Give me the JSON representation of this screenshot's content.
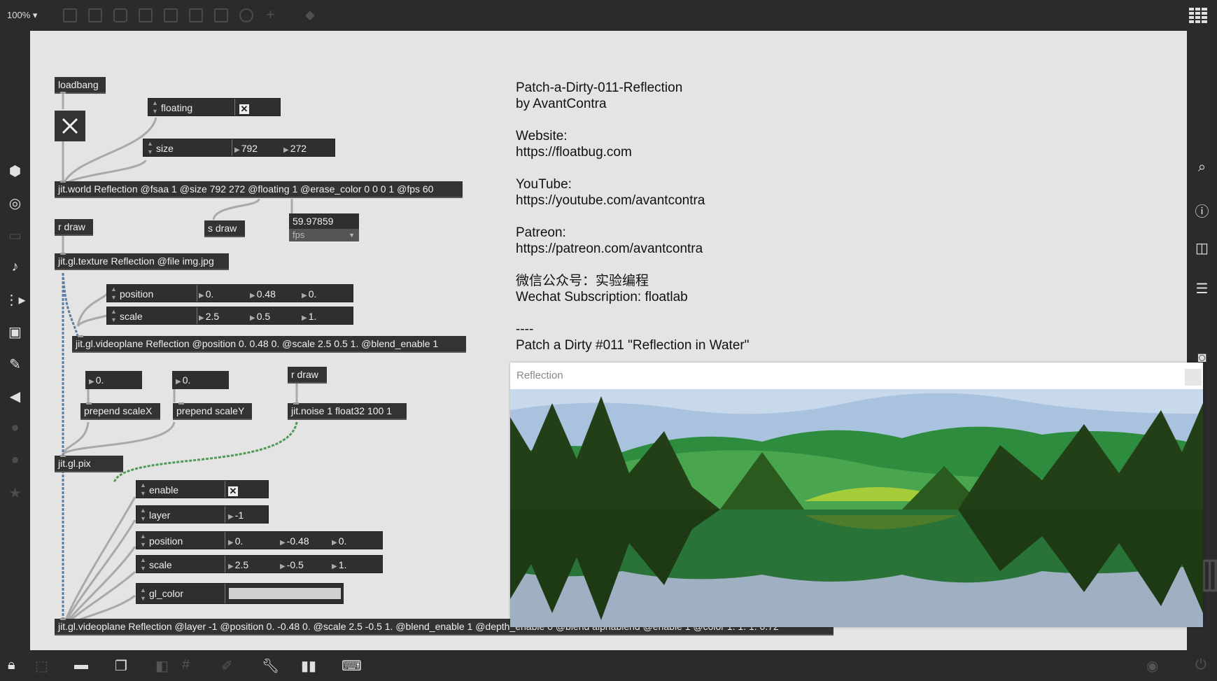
{
  "toolbar": {
    "zoom": "100% ▾"
  },
  "patch": {
    "loadbang": "loadbang",
    "floating_attr": {
      "label": "floating",
      "checked": "✕"
    },
    "size_attr": {
      "label": "size",
      "v1": "792",
      "v2": "272"
    },
    "jit_world": "jit.world Reflection @fsaa 1 @size 792 272 @floating 1 @erase_color 0 0 0 1 @fps 60",
    "r_draw_1": "r draw",
    "s_draw": "s draw",
    "fps_value": "59.97859",
    "fps_label": "fps",
    "texture": "jit.gl.texture Reflection @file img.jpg",
    "position_attr": {
      "label": "position",
      "v1": "0.",
      "v2": "0.48",
      "v3": "0."
    },
    "scale_attr": {
      "label": "scale",
      "v1": "2.5",
      "v2": "0.5",
      "v3": "1."
    },
    "videoplane1": "jit.gl.videoplane Reflection @position 0. 0.48 0. @scale 2.5 0.5 1. @blend_enable 1",
    "num1": "0.",
    "num2": "0.",
    "r_draw_2": "r draw",
    "prepend_x": "prepend scaleX",
    "prepend_y": "prepend scaleY",
    "noise": "jit.noise 1 float32 100 1",
    "pix": "jit.gl.pix",
    "enable_attr": {
      "label": "enable",
      "checked": "✕"
    },
    "layer_attr": {
      "label": "layer",
      "v1": "-1"
    },
    "position2_attr": {
      "label": "position",
      "v1": "0.",
      "v2": "-0.48",
      "v3": "0."
    },
    "scale2_attr": {
      "label": "scale",
      "v1": "2.5",
      "v2": "-0.5",
      "v3": "1."
    },
    "glcolor_attr": {
      "label": "gl_color"
    },
    "videoplane2": "jit.gl.videoplane Reflection @layer -1 @position 0. -0.48 0. @scale 2.5 -0.5 1. @blend_enable 1 @depth_enable 0 @blend alphablend @enable 1 @color 1. 1. 1. 0.72"
  },
  "info_comment": "Patch-a-Dirty-011-Reflection\nby AvantContra\n\nWebsite:\nhttps://floatbug.com\n\nYouTube:\nhttps://youtube.com/avantcontra\n\nPatreon:\nhttps://patreon.com/avantcontra\n\n微信公众号：实验编程\nWechat Subscription: floatlab\n\n----\nPatch a Dirty #011 \"Reflection in Water\"",
  "render_window": {
    "title": "Reflection"
  },
  "colors": {
    "canvas": "#e4e4e4",
    "object": "#333333",
    "chrome": "#2b2b2b"
  }
}
